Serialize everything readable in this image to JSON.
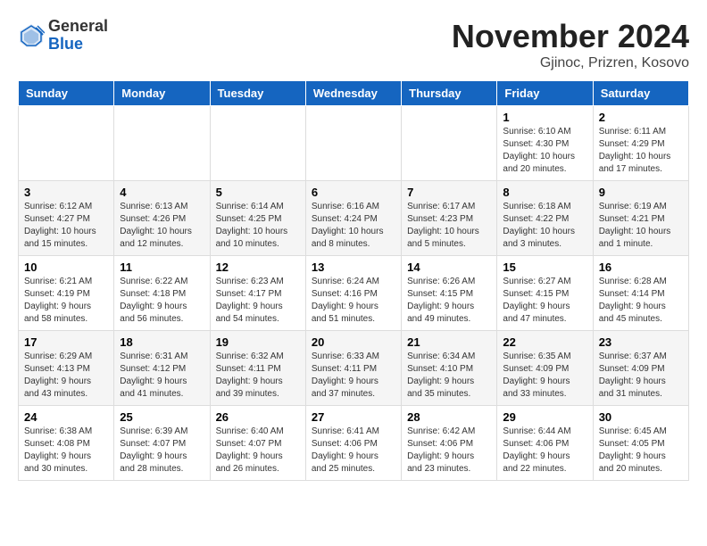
{
  "logo": {
    "general": "General",
    "blue": "Blue"
  },
  "title": "November 2024",
  "subtitle": "Gjinoc, Prizren, Kosovo",
  "days_header": [
    "Sunday",
    "Monday",
    "Tuesday",
    "Wednesday",
    "Thursday",
    "Friday",
    "Saturday"
  ],
  "weeks": [
    [
      {
        "day": "",
        "info": ""
      },
      {
        "day": "",
        "info": ""
      },
      {
        "day": "",
        "info": ""
      },
      {
        "day": "",
        "info": ""
      },
      {
        "day": "",
        "info": ""
      },
      {
        "day": "1",
        "info": "Sunrise: 6:10 AM\nSunset: 4:30 PM\nDaylight: 10 hours\nand 20 minutes."
      },
      {
        "day": "2",
        "info": "Sunrise: 6:11 AM\nSunset: 4:29 PM\nDaylight: 10 hours\nand 17 minutes."
      }
    ],
    [
      {
        "day": "3",
        "info": "Sunrise: 6:12 AM\nSunset: 4:27 PM\nDaylight: 10 hours\nand 15 minutes."
      },
      {
        "day": "4",
        "info": "Sunrise: 6:13 AM\nSunset: 4:26 PM\nDaylight: 10 hours\nand 12 minutes."
      },
      {
        "day": "5",
        "info": "Sunrise: 6:14 AM\nSunset: 4:25 PM\nDaylight: 10 hours\nand 10 minutes."
      },
      {
        "day": "6",
        "info": "Sunrise: 6:16 AM\nSunset: 4:24 PM\nDaylight: 10 hours\nand 8 minutes."
      },
      {
        "day": "7",
        "info": "Sunrise: 6:17 AM\nSunset: 4:23 PM\nDaylight: 10 hours\nand 5 minutes."
      },
      {
        "day": "8",
        "info": "Sunrise: 6:18 AM\nSunset: 4:22 PM\nDaylight: 10 hours\nand 3 minutes."
      },
      {
        "day": "9",
        "info": "Sunrise: 6:19 AM\nSunset: 4:21 PM\nDaylight: 10 hours\nand 1 minute."
      }
    ],
    [
      {
        "day": "10",
        "info": "Sunrise: 6:21 AM\nSunset: 4:19 PM\nDaylight: 9 hours\nand 58 minutes."
      },
      {
        "day": "11",
        "info": "Sunrise: 6:22 AM\nSunset: 4:18 PM\nDaylight: 9 hours\nand 56 minutes."
      },
      {
        "day": "12",
        "info": "Sunrise: 6:23 AM\nSunset: 4:17 PM\nDaylight: 9 hours\nand 54 minutes."
      },
      {
        "day": "13",
        "info": "Sunrise: 6:24 AM\nSunset: 4:16 PM\nDaylight: 9 hours\nand 51 minutes."
      },
      {
        "day": "14",
        "info": "Sunrise: 6:26 AM\nSunset: 4:15 PM\nDaylight: 9 hours\nand 49 minutes."
      },
      {
        "day": "15",
        "info": "Sunrise: 6:27 AM\nSunset: 4:15 PM\nDaylight: 9 hours\nand 47 minutes."
      },
      {
        "day": "16",
        "info": "Sunrise: 6:28 AM\nSunset: 4:14 PM\nDaylight: 9 hours\nand 45 minutes."
      }
    ],
    [
      {
        "day": "17",
        "info": "Sunrise: 6:29 AM\nSunset: 4:13 PM\nDaylight: 9 hours\nand 43 minutes."
      },
      {
        "day": "18",
        "info": "Sunrise: 6:31 AM\nSunset: 4:12 PM\nDaylight: 9 hours\nand 41 minutes."
      },
      {
        "day": "19",
        "info": "Sunrise: 6:32 AM\nSunset: 4:11 PM\nDaylight: 9 hours\nand 39 minutes."
      },
      {
        "day": "20",
        "info": "Sunrise: 6:33 AM\nSunset: 4:11 PM\nDaylight: 9 hours\nand 37 minutes."
      },
      {
        "day": "21",
        "info": "Sunrise: 6:34 AM\nSunset: 4:10 PM\nDaylight: 9 hours\nand 35 minutes."
      },
      {
        "day": "22",
        "info": "Sunrise: 6:35 AM\nSunset: 4:09 PM\nDaylight: 9 hours\nand 33 minutes."
      },
      {
        "day": "23",
        "info": "Sunrise: 6:37 AM\nSunset: 4:09 PM\nDaylight: 9 hours\nand 31 minutes."
      }
    ],
    [
      {
        "day": "24",
        "info": "Sunrise: 6:38 AM\nSunset: 4:08 PM\nDaylight: 9 hours\nand 30 minutes."
      },
      {
        "day": "25",
        "info": "Sunrise: 6:39 AM\nSunset: 4:07 PM\nDaylight: 9 hours\nand 28 minutes."
      },
      {
        "day": "26",
        "info": "Sunrise: 6:40 AM\nSunset: 4:07 PM\nDaylight: 9 hours\nand 26 minutes."
      },
      {
        "day": "27",
        "info": "Sunrise: 6:41 AM\nSunset: 4:06 PM\nDaylight: 9 hours\nand 25 minutes."
      },
      {
        "day": "28",
        "info": "Sunrise: 6:42 AM\nSunset: 4:06 PM\nDaylight: 9 hours\nand 23 minutes."
      },
      {
        "day": "29",
        "info": "Sunrise: 6:44 AM\nSunset: 4:06 PM\nDaylight: 9 hours\nand 22 minutes."
      },
      {
        "day": "30",
        "info": "Sunrise: 6:45 AM\nSunset: 4:05 PM\nDaylight: 9 hours\nand 20 minutes."
      }
    ]
  ]
}
